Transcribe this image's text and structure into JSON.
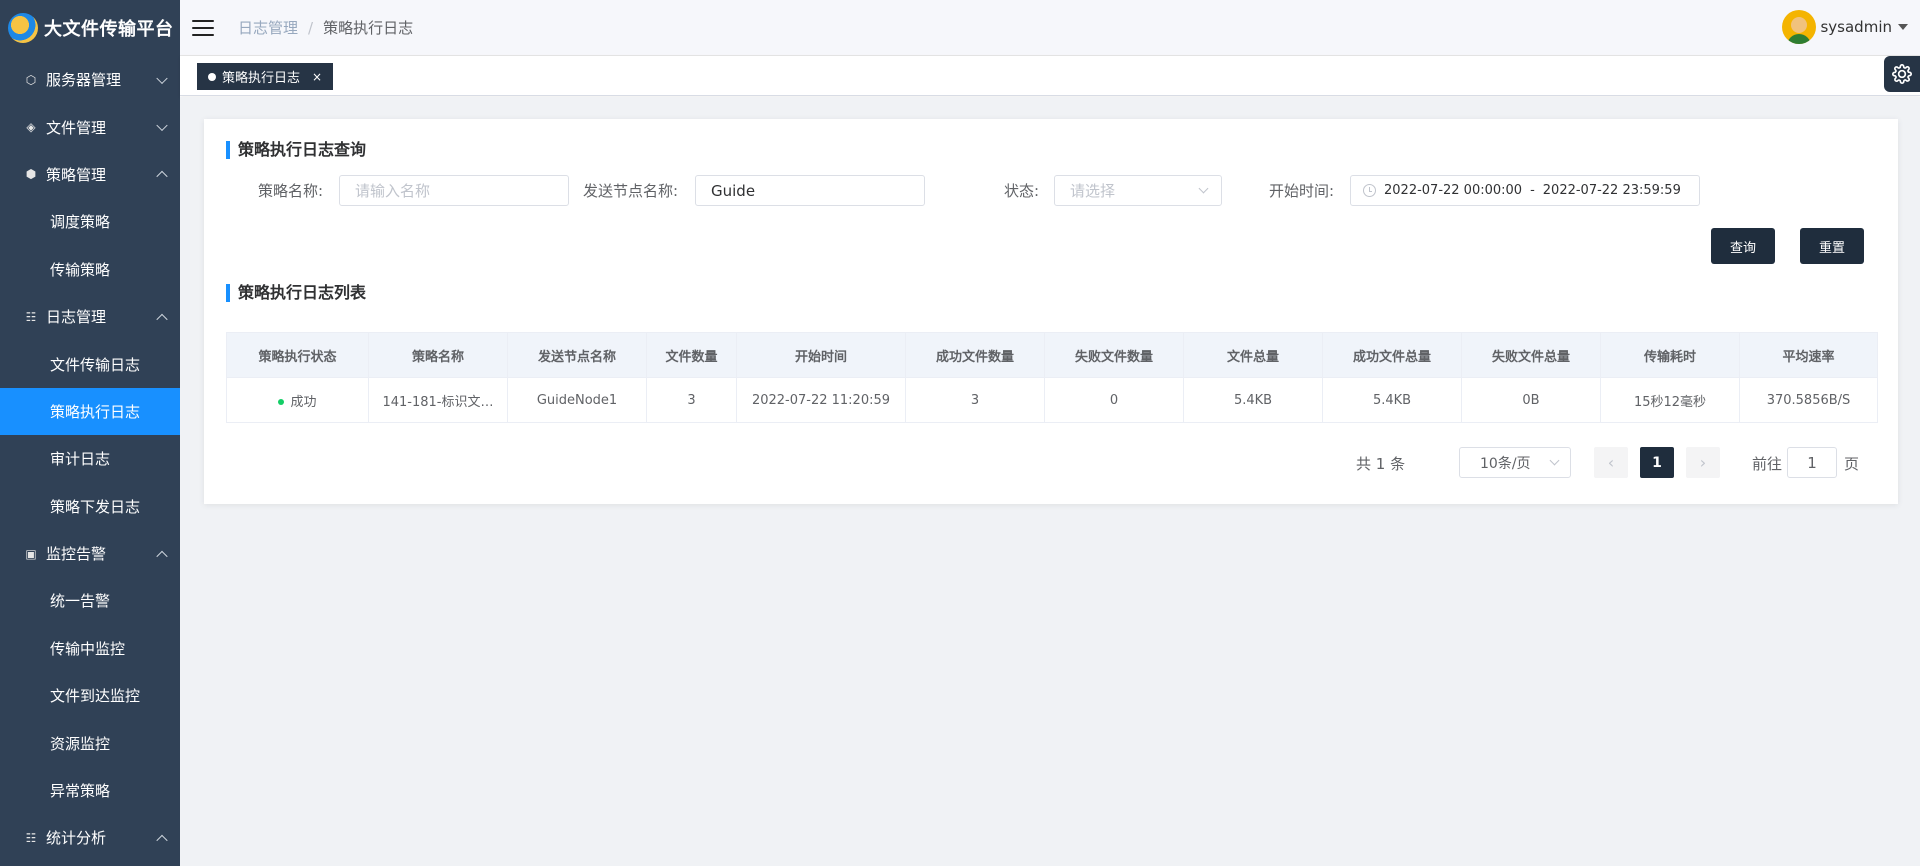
{
  "app": {
    "title": "大文件传输平台"
  },
  "sidebar": {
    "items": [
      {
        "label": "服务器管理",
        "type": "group",
        "icon": "server-icon",
        "expanded": false
      },
      {
        "label": "文件管理",
        "type": "group",
        "icon": "layers-icon",
        "expanded": false
      },
      {
        "label": "策略管理",
        "type": "group",
        "icon": "strategy-icon",
        "expanded": true
      },
      {
        "label": "调度策略",
        "type": "child"
      },
      {
        "label": "传输策略",
        "type": "child"
      },
      {
        "label": "日志管理",
        "type": "group",
        "icon": "log-icon",
        "expanded": true
      },
      {
        "label": "文件传输日志",
        "type": "child"
      },
      {
        "label": "策略执行日志",
        "type": "child",
        "active": true
      },
      {
        "label": "审计日志",
        "type": "child"
      },
      {
        "label": "策略下发日志",
        "type": "child"
      },
      {
        "label": "监控告警",
        "type": "group",
        "icon": "monitor-icon",
        "expanded": true
      },
      {
        "label": "统一告警",
        "type": "child"
      },
      {
        "label": "传输中监控",
        "type": "child"
      },
      {
        "label": "文件到达监控",
        "type": "child"
      },
      {
        "label": "资源监控",
        "type": "child"
      },
      {
        "label": "异常策略",
        "type": "child"
      },
      {
        "label": "统计分析",
        "type": "group",
        "icon": "stats-icon",
        "expanded": true
      }
    ]
  },
  "header": {
    "breadcrumb": [
      "日志管理",
      "策略执行日志"
    ],
    "separator": "/",
    "username": "sysadmin"
  },
  "tags": [
    {
      "label": "策略执行日志",
      "close": "×"
    }
  ],
  "search": {
    "title": "策略执行日志查询",
    "policy_name_label": "策略名称:",
    "policy_name_placeholder": "请输入名称",
    "node_name_label": "发送节点名称:",
    "node_name_value": "Guide",
    "status_label": "状态:",
    "status_placeholder": "请选择",
    "start_time_label": "开始时间:",
    "start_time_from": "2022-07-22 00:00:00",
    "start_time_sep": "-",
    "start_time_to": "2022-07-22 23:59:59",
    "query_button": "查询",
    "reset_button": "重置"
  },
  "list": {
    "title": "策略执行日志列表",
    "columns": [
      "策略执行状态",
      "策略名称",
      "发送节点名称",
      "文件数量",
      "开始时间",
      "成功文件数量",
      "失败文件数量",
      "文件总量",
      "成功文件总量",
      "失败文件总量",
      "传输耗时",
      "平均速率"
    ],
    "rows": [
      [
        "成功",
        "141-181-标识文…",
        "GuideNode1",
        "3",
        "2022-07-22 11:20:59",
        "3",
        "0",
        "5.4KB",
        "5.4KB",
        "0B",
        "15秒12毫秒",
        "370.5856B/S"
      ]
    ]
  },
  "pagination": {
    "total": "共 1 条",
    "page_size": "10条/页",
    "prev": "‹",
    "current": "1",
    "next": "›",
    "goto_label": "前往",
    "goto_value": "1",
    "page_suffix": "页"
  },
  "colors": {
    "sidebar_bg": "#304156",
    "active_menu": "#1890ff",
    "dark_button": "#1f2d3d",
    "success": "#13ce66"
  }
}
